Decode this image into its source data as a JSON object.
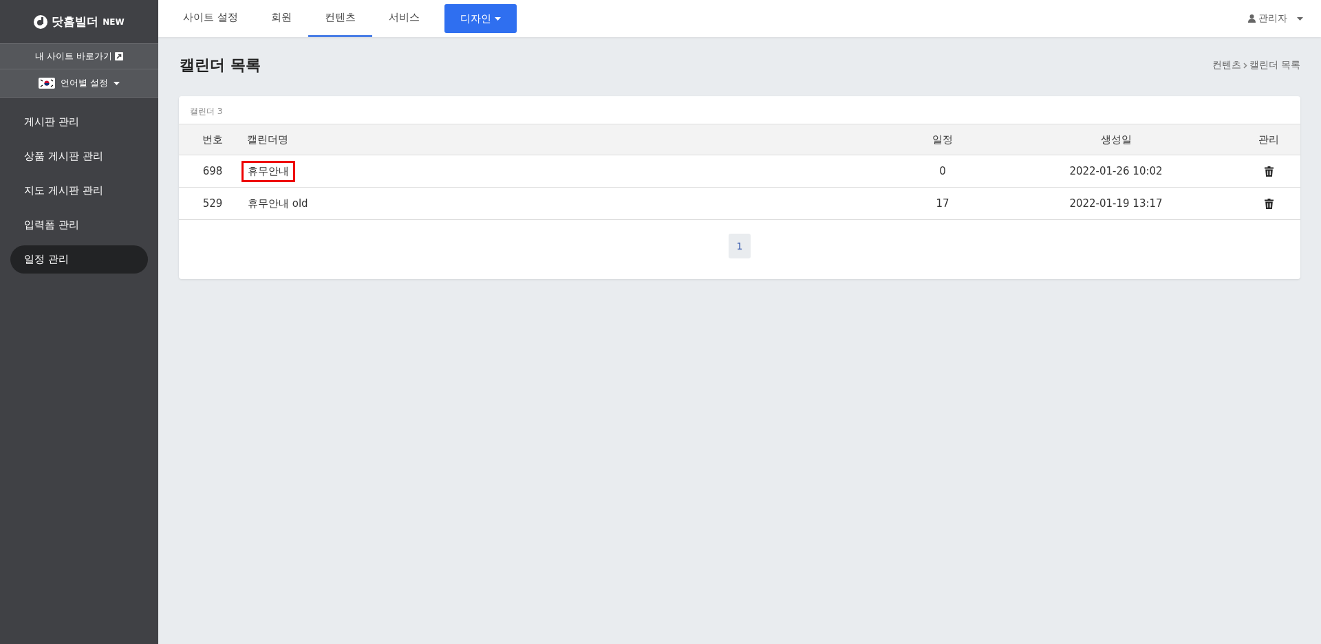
{
  "sidebar": {
    "logo": "닷홈빌더",
    "logo_badge": "NEW",
    "site_link": "내 사이트 바로가기",
    "language": "언어별 설정",
    "items": [
      {
        "label": "게시판 관리",
        "selected": false
      },
      {
        "label": "상품 게시판 관리",
        "selected": false
      },
      {
        "label": "지도 게시판 관리",
        "selected": false
      },
      {
        "label": "입력폼 관리",
        "selected": false
      },
      {
        "label": "일정 관리",
        "selected": true
      }
    ]
  },
  "topnav": {
    "tabs": [
      {
        "label": "사이트 설정",
        "kind": "tab",
        "selected": false
      },
      {
        "label": "회원",
        "kind": "tab",
        "selected": false
      },
      {
        "label": "컨텐츠",
        "kind": "tab",
        "selected": true
      },
      {
        "label": "서비스",
        "kind": "tab",
        "selected": false
      },
      {
        "label": "디자인",
        "kind": "dropdown",
        "selected": false
      }
    ],
    "user": "관리자"
  },
  "page": {
    "title": "캘린더 목록",
    "breadcrumb": [
      "컨텐츠",
      "캘린더 목록"
    ]
  },
  "table": {
    "caption": "캘린더 3",
    "columns": [
      "번호",
      "캘린더명",
      "일정",
      "생성일",
      "관리"
    ],
    "rows": [
      {
        "number": "698",
        "name": "휴무안내",
        "highlighted": true,
        "events": "0",
        "created": "2022-01-26 10:02"
      },
      {
        "number": "529",
        "name": "휴무안내 old",
        "highlighted": false,
        "events": "17",
        "created": "2022-01-19 13:17"
      }
    ]
  },
  "pagination": [
    {
      "label": "1",
      "selected": true
    }
  ]
}
